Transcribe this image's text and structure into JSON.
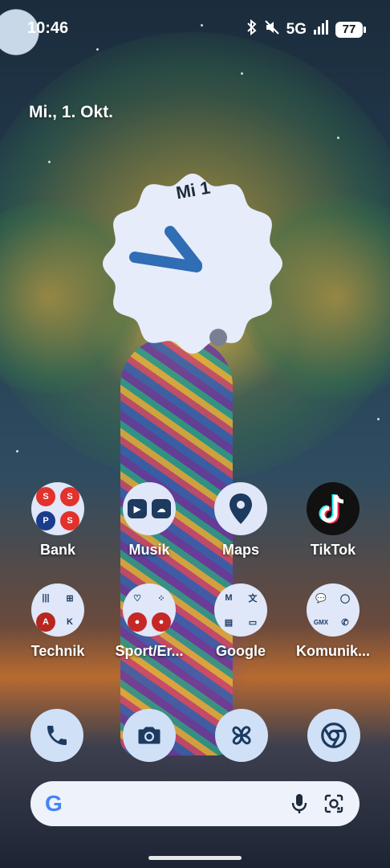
{
  "status_bar": {
    "time": "10:46",
    "network": "5G",
    "battery": "77",
    "icons": [
      "bluetooth-icon",
      "mute-icon",
      "signal-icon"
    ]
  },
  "date_widget": {
    "text": "Mi., 1. Okt."
  },
  "clock_widget": {
    "day_label": "Mi 1"
  },
  "apps": [
    {
      "label": "Bank"
    },
    {
      "label": "Musik"
    },
    {
      "label": "Maps"
    },
    {
      "label": "TikTok"
    },
    {
      "label": "Technik"
    },
    {
      "label": "Sport/Er..."
    },
    {
      "label": "Google"
    },
    {
      "label": "Komunik..."
    }
  ],
  "folder_mini": {
    "gmx": "GMX"
  },
  "dock": [
    "phone-icon",
    "camera-icon",
    "pinwheel-icon",
    "chrome-icon"
  ],
  "search": {
    "logo": "G"
  },
  "colors": {
    "accent_blue": "#2f6db4",
    "clock_face": "#e6ecfa",
    "folder_bg": "#dfe7f8"
  }
}
